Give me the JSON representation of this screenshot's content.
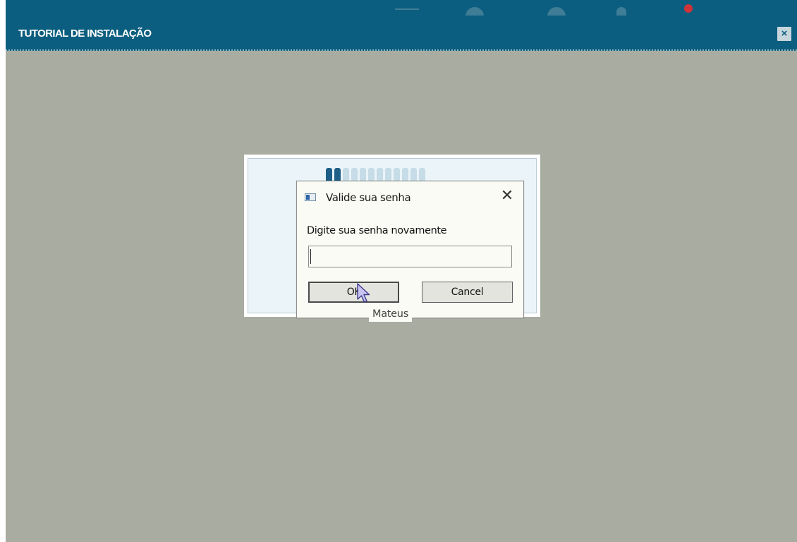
{
  "tutorial_window": {
    "title": "TUTORIAL DE INSTALAÇÃO",
    "close_symbol": "×"
  },
  "installer": {
    "progress": {
      "segments_total": 12,
      "segments_filled": 2
    }
  },
  "dialog": {
    "title": "Valide sua senha",
    "close_symbol": "✕",
    "prompt": "Digite sua senha novamente",
    "password_value": "",
    "ok_label": "OK",
    "cancel_label": "Cancel"
  },
  "tooltip": {
    "text": "Mateus"
  },
  "colors": {
    "titlebar": "#0b5e7f",
    "workspace": "#a9aca1",
    "progress_filled": "#1d5f87",
    "progress_empty": "#c6dce6"
  },
  "icons": {
    "dialog_app": "window-app-icon",
    "cursor": "mouse-pointer-icon"
  }
}
